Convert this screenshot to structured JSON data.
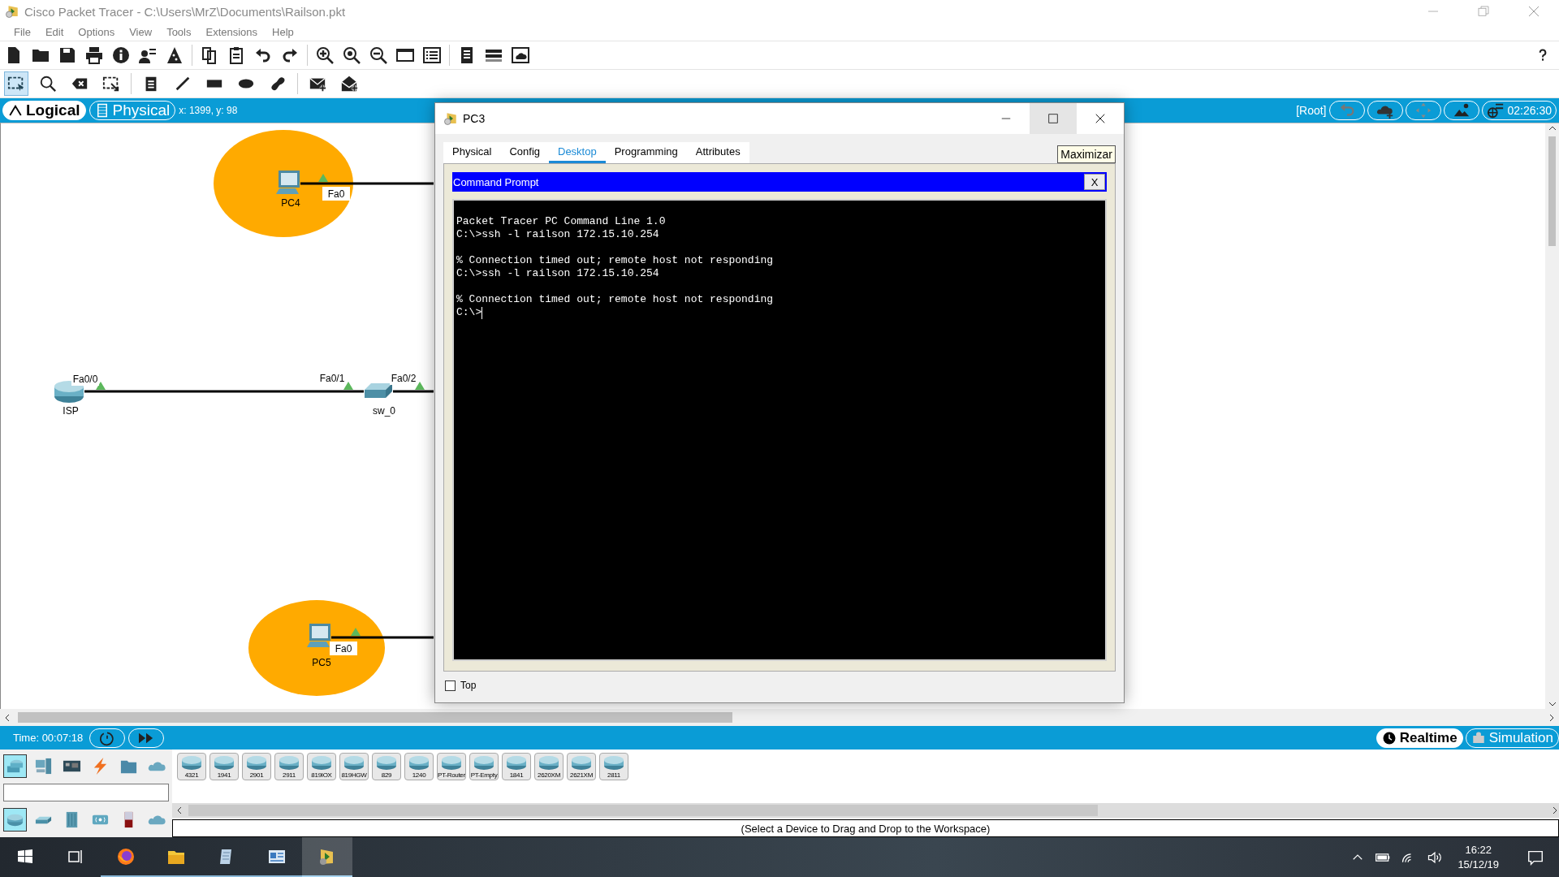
{
  "window": {
    "title": "Cisco Packet Tracer - C:\\Users\\MrZ\\Documents\\Railson.pkt"
  },
  "menu": [
    "File",
    "Edit",
    "Options",
    "View",
    "Tools",
    "Extensions",
    "Help"
  ],
  "edit_tools": [
    {
      "kind": "select",
      "selected": true
    },
    {
      "kind": "inspect",
      "selected": false
    },
    {
      "kind": "delete",
      "selected": false
    },
    {
      "kind": "resize",
      "selected": false
    },
    {
      "kind": "note",
      "selected": false
    },
    {
      "kind": "line",
      "selected": false
    },
    {
      "kind": "rectangle",
      "selected": false
    },
    {
      "kind": "ellipse",
      "selected": false
    },
    {
      "kind": "freeform",
      "selected": false
    },
    {
      "kind": "simple_pdu",
      "selected": false
    },
    {
      "kind": "complex_pdu",
      "selected": false
    }
  ],
  "mode_bar": {
    "tabs": [
      {
        "label": "Logical",
        "selected": true
      },
      {
        "label": "Physical",
        "selected": false
      }
    ],
    "coordinates": "x: 1399, y: 98",
    "root": "[Root]",
    "buttons": [
      {
        "kind": "back"
      },
      {
        "kind": "cluster"
      },
      {
        "kind": "move"
      },
      {
        "kind": "background"
      },
      {
        "kind": "viewport",
        "text": "02:26:30"
      }
    ]
  },
  "workspace": {
    "devices": [
      {
        "kind": "pc",
        "name": "PC4",
        "highlighted": true,
        "ports": [
          {
            "label": "Fa0",
            "link_up": true
          }
        ]
      },
      {
        "kind": "router",
        "name": "ISP",
        "highlighted": false,
        "ports": [
          {
            "label": "Fa0/0",
            "link_up": true
          }
        ]
      },
      {
        "kind": "switch",
        "name": "sw_0",
        "highlighted": false,
        "ports": [
          {
            "label": "Fa0/1",
            "link_up": true
          },
          {
            "label": "Fa0/2",
            "link_up": true
          }
        ]
      },
      {
        "kind": "pc",
        "name": "PC5",
        "highlighted": true,
        "ports": [
          {
            "label": "Fa0",
            "link_up": true
          }
        ]
      }
    ]
  },
  "device_window": {
    "title": "PC3",
    "tabs": [
      {
        "label": "Physical",
        "selected": false
      },
      {
        "label": "Config",
        "selected": false
      },
      {
        "label": "Desktop",
        "selected": true
      },
      {
        "label": "Programming",
        "selected": false
      },
      {
        "label": "Attributes",
        "selected": false
      }
    ],
    "maximize_button": "Maximizar",
    "command_prompt": {
      "title": "Command Prompt",
      "close": "X",
      "output": "Packet Tracer PC Command Line 1.0\nC:\\>ssh -l railson 172.15.10.254\n\n% Connection timed out; remote host not responding\nC:\\>ssh -l railson 172.15.10.254\n\n% Connection timed out; remote host not responding",
      "prompt": "C:\\>"
    },
    "top_checkbox": {
      "label": "Top",
      "checked": false
    }
  },
  "time_bar": {
    "time": "Time: 00:07:18",
    "modes": [
      {
        "label": "Realtime",
        "selected": true
      },
      {
        "label": "Simulation",
        "selected": false
      }
    ]
  },
  "device_panel": {
    "categories": [
      {
        "kind": "network",
        "selected": true
      },
      {
        "kind": "end",
        "selected": false
      },
      {
        "kind": "components",
        "selected": false
      },
      {
        "kind": "connections",
        "selected": false
      },
      {
        "kind": "misc",
        "selected": false
      },
      {
        "kind": "multiuser",
        "selected": false
      }
    ],
    "subcategories": [
      {
        "kind": "router",
        "selected": true
      },
      {
        "kind": "switch",
        "selected": false
      },
      {
        "kind": "hub",
        "selected": false
      },
      {
        "kind": "wireless",
        "selected": false
      },
      {
        "kind": "security",
        "selected": false
      },
      {
        "kind": "wan",
        "selected": false
      }
    ],
    "models": [
      "4321",
      "1941",
      "2901",
      "2911",
      "819IOX",
      "819HGW",
      "829",
      "1240",
      "PT-Router",
      "PT-Empty",
      "1841",
      "2620XM",
      "2621XM",
      "2811"
    ],
    "hint": "(Select a Device to Drag and Drop to the Workspace)"
  },
  "taskbar": {
    "apps": [
      {
        "kind": "start",
        "running": false,
        "active": false
      },
      {
        "kind": "task_view",
        "running": false,
        "active": false
      },
      {
        "kind": "firefox",
        "running": true,
        "active": false
      },
      {
        "kind": "explorer",
        "running": true,
        "active": false
      },
      {
        "kind": "notes",
        "running": true,
        "active": false
      },
      {
        "kind": "control",
        "running": true,
        "active": false
      },
      {
        "kind": "packet_tracer",
        "running": true,
        "active": true
      }
    ],
    "time": "16:22",
    "date": "15/12/19"
  }
}
